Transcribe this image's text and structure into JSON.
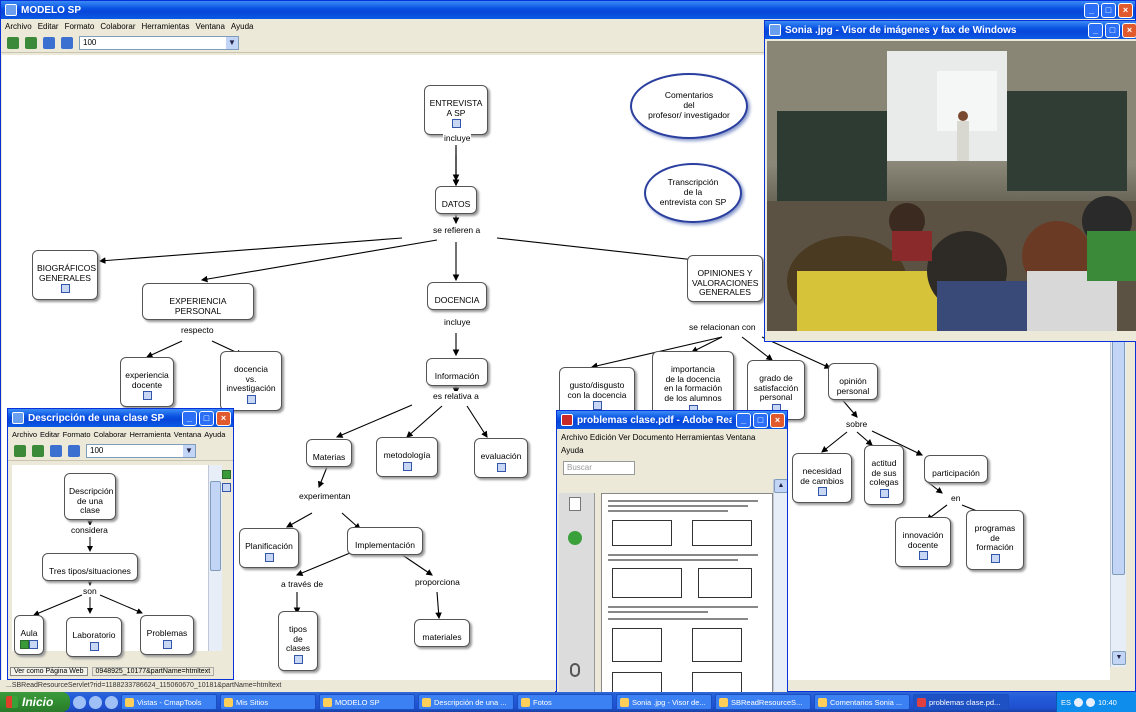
{
  "main_window": {
    "title": "MODELO SP",
    "menu": [
      "Archivo",
      "Editar",
      "Formato",
      "Colaborar",
      "Herramientas",
      "Ventana",
      "Ayuda"
    ],
    "zoom": "100"
  },
  "concept_map": {
    "nodes": {
      "entrevista": "ENTREVISTA\nA SP",
      "comentarios": "Comentarios\ndel\nprofesor/ investigador",
      "transcripcion": "Transcripción\nde la\nentrevista con SP",
      "datos": "DATOS",
      "biograficos": "BIOGRÁFICOS\nGENERALES",
      "experiencia_personal": "EXPERIENCIA PERSONAL",
      "docencia": "DOCENCIA",
      "opiniones": "OPINIONES Y\nVALORACIONES\nGENERALES",
      "experiencia_docente": "experiencia\ndocente",
      "docencia_vs": "docencia\nvs.\ninvestigación",
      "informacion": "Información",
      "gusto": "gusto/disgusto\ncon la docencia",
      "importancia": "importancia\nde la docencia\nen  la formación\nde los alumnos",
      "grado": "grado de\nsatisfacción\npersonal",
      "opinion": "opinión\npersonal",
      "materias": "Materias",
      "metodologia": "metodología",
      "evaluacion": "evaluación",
      "necesidad": "necesidad\nde cambios",
      "actitud": "actitud\nde sus\ncolegas",
      "participacion": "participación",
      "planificacion": "Planificación",
      "implementacion": "Implementación",
      "innovacion": "innovación\ndocente",
      "programas": "programas\nde\nformación",
      "tipos": "tipos\nde\nclases",
      "materiales": "materiales"
    },
    "links": {
      "incluye1": "incluye",
      "se_refieren": "se refieren a",
      "respecto": "respecto",
      "incluye2": "incluye",
      "se_relacionan": "se relacionan con",
      "es_relativa": "es relativa a",
      "sobre": "sobre",
      "experimentan": "experimentan",
      "en": "en",
      "a_traves": "a través de",
      "proporciona": "proporciona"
    }
  },
  "viewer_window": {
    "title": "Sonia .jpg - Visor de imágenes y fax de Windows"
  },
  "desc_window": {
    "title": "Descripción de una clase SP",
    "menu": [
      "Archivo",
      "Editar",
      "Formato",
      "Colaborar",
      "Herramienta",
      "Ventana",
      "Ayuda"
    ],
    "zoom": "100",
    "nodes": {
      "descripcion": "Descripción\nde una\nclase",
      "tres_tipos": "Tres tipos/situaciones",
      "aula": "Aula",
      "laboratorio": "Laboratorio",
      "problemas": "Problemas"
    },
    "links": {
      "considera": "considera",
      "son": "son"
    },
    "status_button": "Ver como Página Web",
    "status_text": "0948925_10177&partName=htmltext"
  },
  "pdf_window": {
    "title": "problemas clase.pdf - Adobe Reader",
    "menu": [
      "Archivo",
      "Edición",
      "Ver",
      "Documento",
      "Herramientas",
      "Ventana",
      "Ayuda"
    ],
    "search_placeholder": "Buscar"
  },
  "statusbar": "Ver como Página Web     http://cmapster.ihmc.us/rid=1188233786624_115060670_10181&partName=htmltext",
  "statusbar_url": "...SBReadResourceServlet?rid=1188233786624_115060670_10181&partName=htmltext",
  "taskbar": {
    "start": "Inicio",
    "tasks": [
      "Vistas - CmapTools",
      "Mis Sitios",
      "MODELO SP",
      "Descripción de una ...",
      "Fotos",
      "Sonia .jpg - Visor de...",
      "SBReadResourceS...",
      "Comentarios Sonia ...",
      "problemas clase.pd..."
    ],
    "lang": "ES",
    "time": "10:40"
  }
}
